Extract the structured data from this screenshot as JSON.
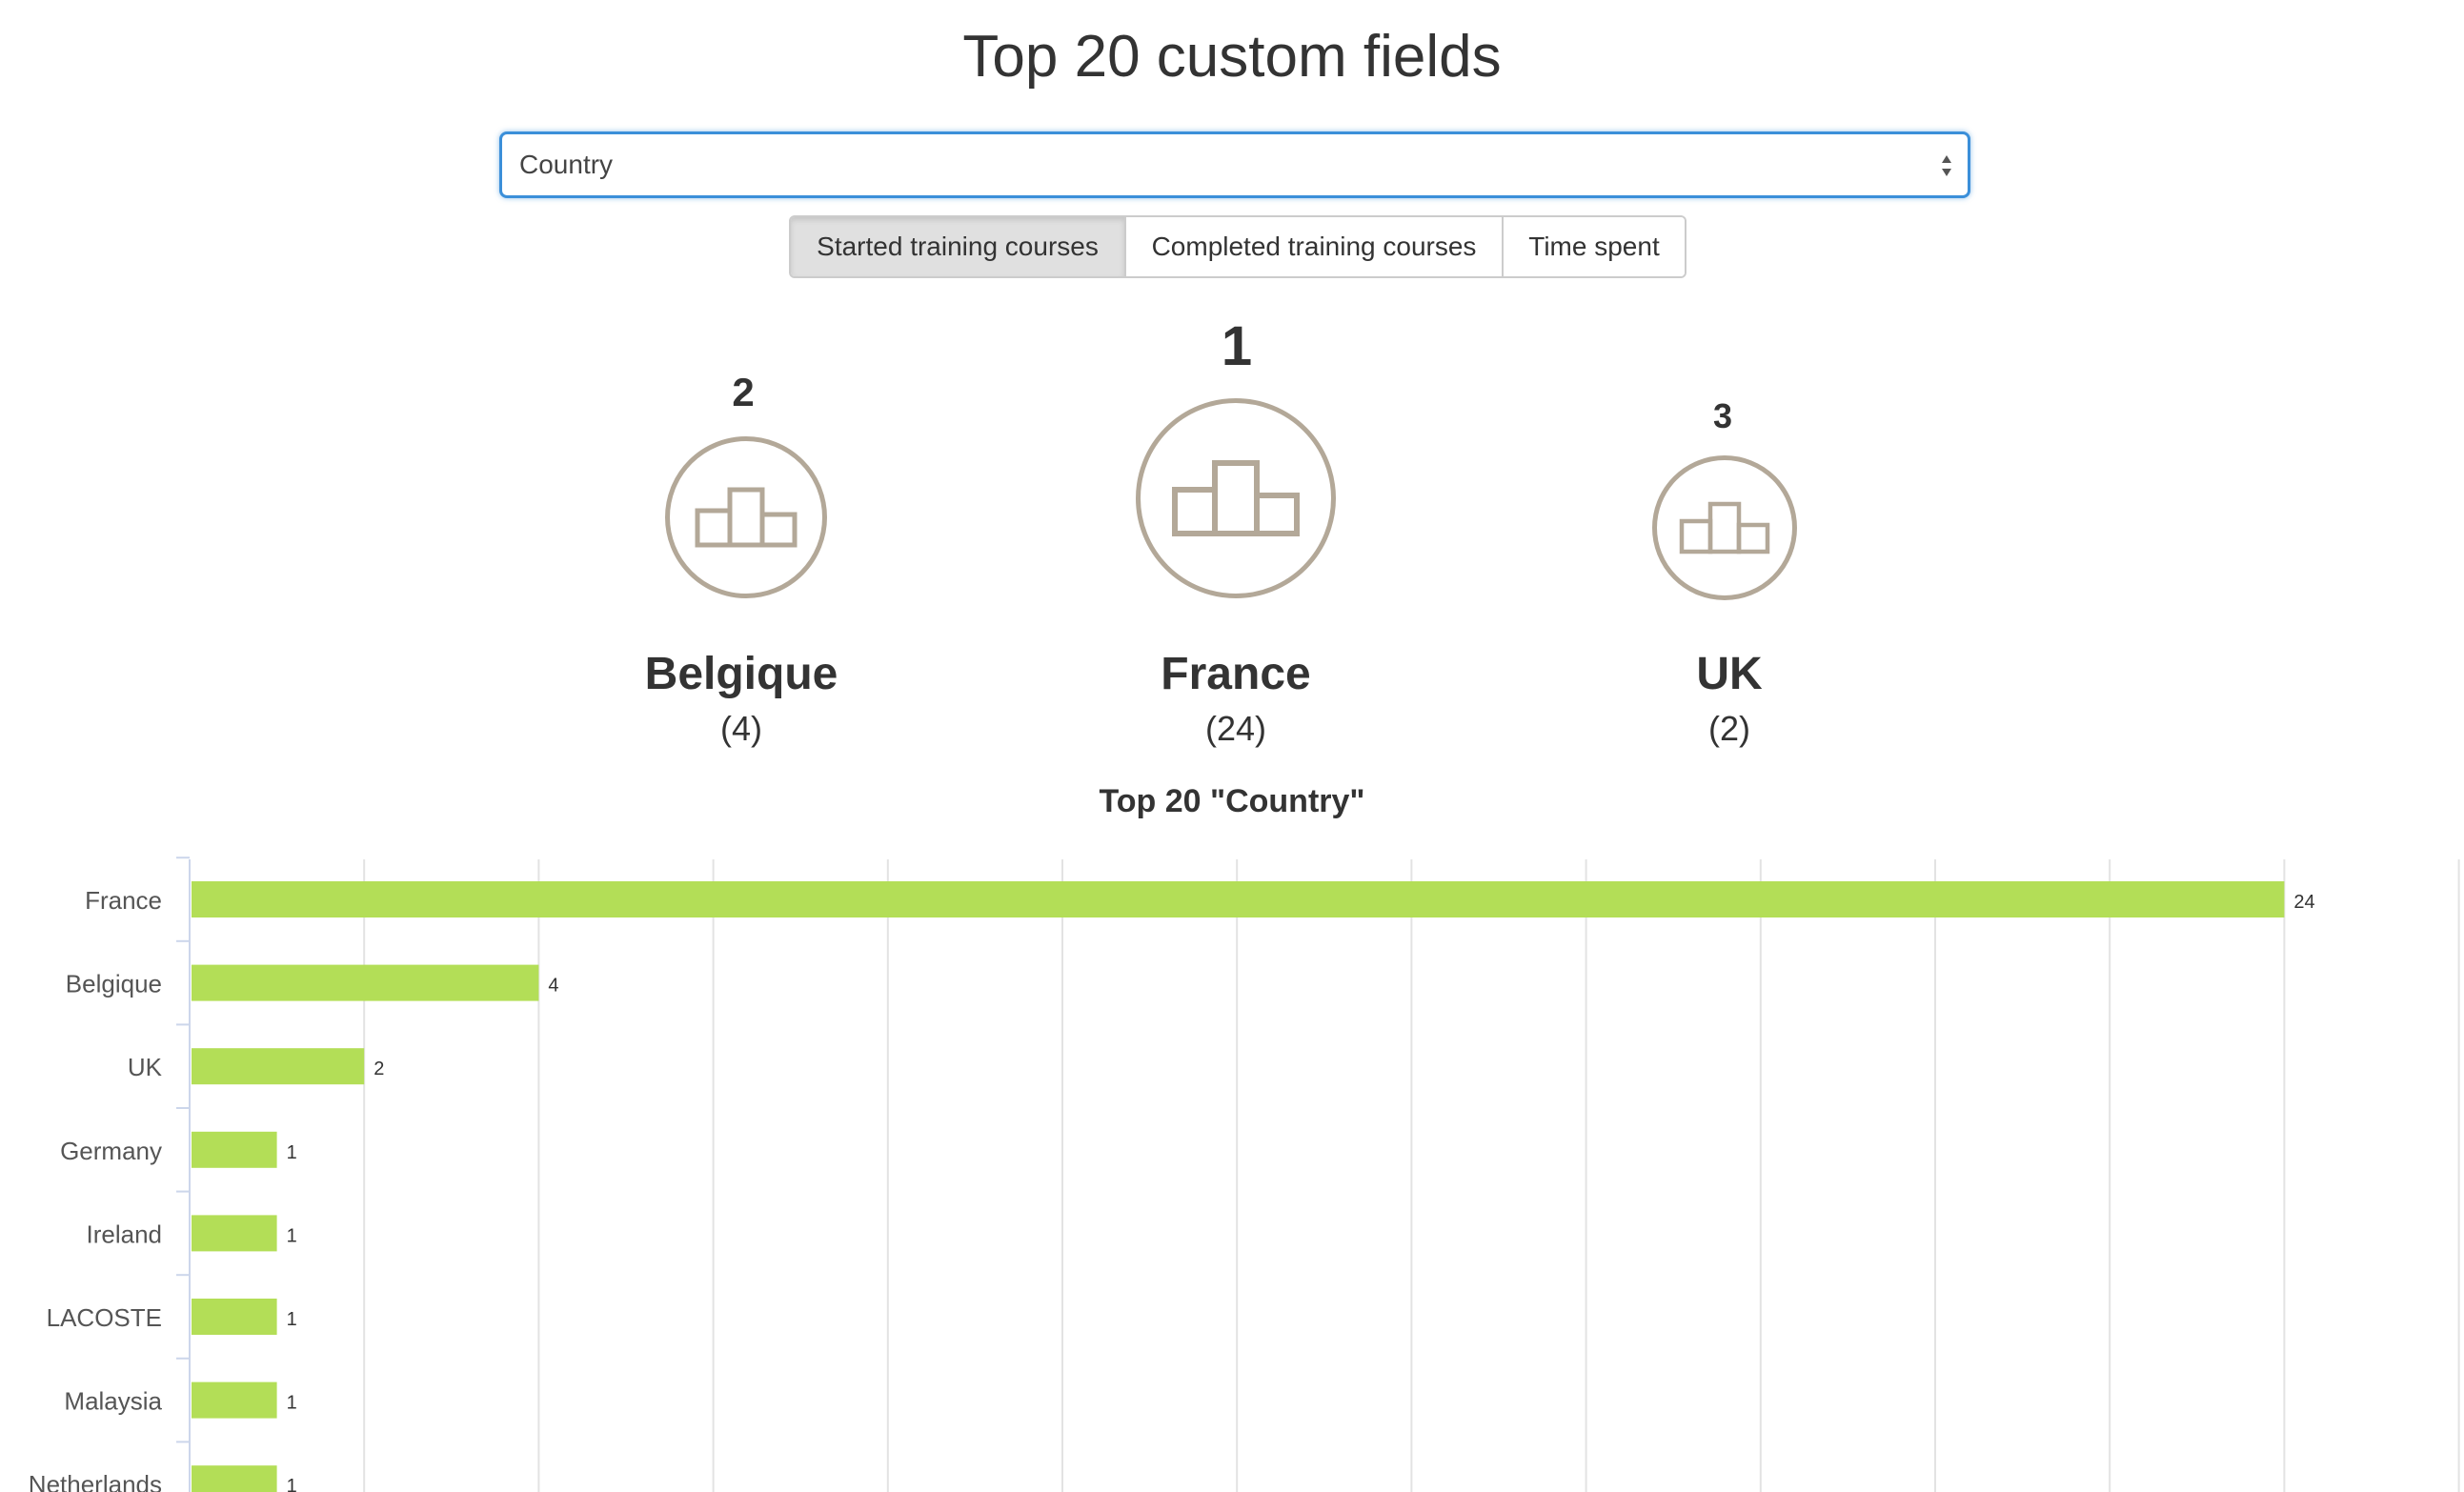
{
  "page": {
    "title": "Top 20 custom fields"
  },
  "field_select": {
    "selected": "Country"
  },
  "tabs": [
    {
      "label": "Started training courses",
      "active": true
    },
    {
      "label": "Completed training courses",
      "active": false
    },
    {
      "label": "Time spent",
      "active": false
    }
  ],
  "podium": {
    "first": {
      "rank": "1",
      "name": "France",
      "count": "(24)",
      "icon": "podium-icon"
    },
    "second": {
      "rank": "2",
      "name": "Belgique",
      "count": "(4)",
      "icon": "podium-icon"
    },
    "third": {
      "rank": "3",
      "name": "UK",
      "count": "(2)",
      "icon": "podium-icon"
    }
  },
  "colors": {
    "bar": "#b3de57",
    "podium_icon": "#b3a898",
    "select_focus": "#3b8fd9"
  },
  "chart_data": {
    "type": "bar",
    "orientation": "horizontal",
    "title": "Top 20 \"Country\"",
    "categories": [
      "France",
      "Belgique",
      "UK",
      "Germany",
      "Ireland",
      "LACOSTE",
      "Malaysia",
      "Netherlands"
    ],
    "values": [
      24,
      4,
      2,
      1,
      1,
      1,
      1,
      1
    ],
    "xlim": [
      0,
      26
    ],
    "grid": true,
    "data_labels": true
  }
}
